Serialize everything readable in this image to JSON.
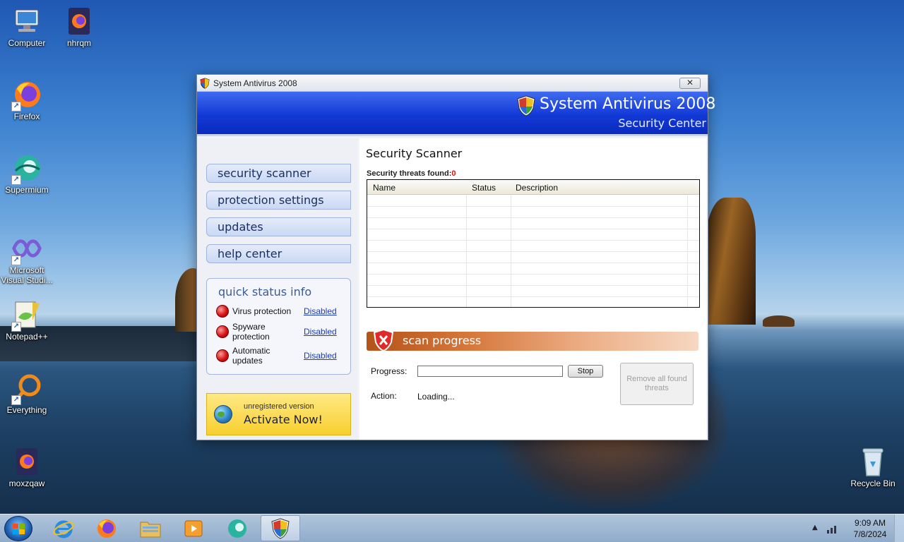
{
  "desktop": {
    "icons": [
      {
        "label": "Computer",
        "icon": "computer-icon"
      },
      {
        "label": "nhrqm",
        "icon": "firefox-file-icon"
      },
      {
        "label": "Firefox",
        "icon": "firefox-icon"
      },
      {
        "label": "Supermium",
        "icon": "supermium-icon"
      },
      {
        "label": "Microsoft Visual Studi...",
        "icon": "visual-studio-icon"
      },
      {
        "label": "Notepad++",
        "icon": "notepad-plus-plus-icon"
      },
      {
        "label": "Everything",
        "icon": "everything-search-icon"
      },
      {
        "label": "moxzqaw",
        "icon": "firefox-file-icon"
      },
      {
        "label": "Recycle Bin",
        "icon": "recycle-bin-icon"
      }
    ]
  },
  "window": {
    "title": "System Antivirus 2008",
    "close_label": "✕",
    "banner": {
      "brand": "System Antivirus 2008",
      "subtitle": "Security Center"
    },
    "sidebar": {
      "nav": [
        {
          "label": "security scanner"
        },
        {
          "label": "protection settings"
        },
        {
          "label": "updates"
        },
        {
          "label": "help center"
        }
      ],
      "status": {
        "heading": "quick status info",
        "items": [
          {
            "name": "Virus protection",
            "state": "Disabled"
          },
          {
            "name": "Spyware protection",
            "state": "Disabled"
          },
          {
            "name": "Automatic updates",
            "state": "Disabled"
          }
        ]
      },
      "activate": {
        "small": "unregistered version",
        "big": "Activate Now!"
      }
    },
    "main": {
      "heading": "Security Scanner",
      "threats_label": "Security threats found:",
      "threats_count": "0",
      "columns": [
        "Name",
        "Status",
        "Description"
      ],
      "progress_title": "scan progress",
      "progress_label": "Progress:",
      "progress_value": 0,
      "stop_label": "Stop",
      "action_label": "Action:",
      "action_value": "Loading...",
      "remove_label": "Remove all found threats"
    }
  },
  "taskbar": {
    "time": "9:09 AM",
    "date": "7/8/2024",
    "pinned": [
      "internet-explorer-icon",
      "firefox-icon",
      "file-explorer-icon",
      "media-player-icon",
      "supermium-icon",
      "system-antivirus-icon"
    ]
  },
  "colors": {
    "banner_blue": "#1339d6",
    "danger_red": "#d41414",
    "link_blue": "#1a3ac8",
    "activate_yellow": "#f7cf2e",
    "progress_orange": "#d5763a"
  }
}
